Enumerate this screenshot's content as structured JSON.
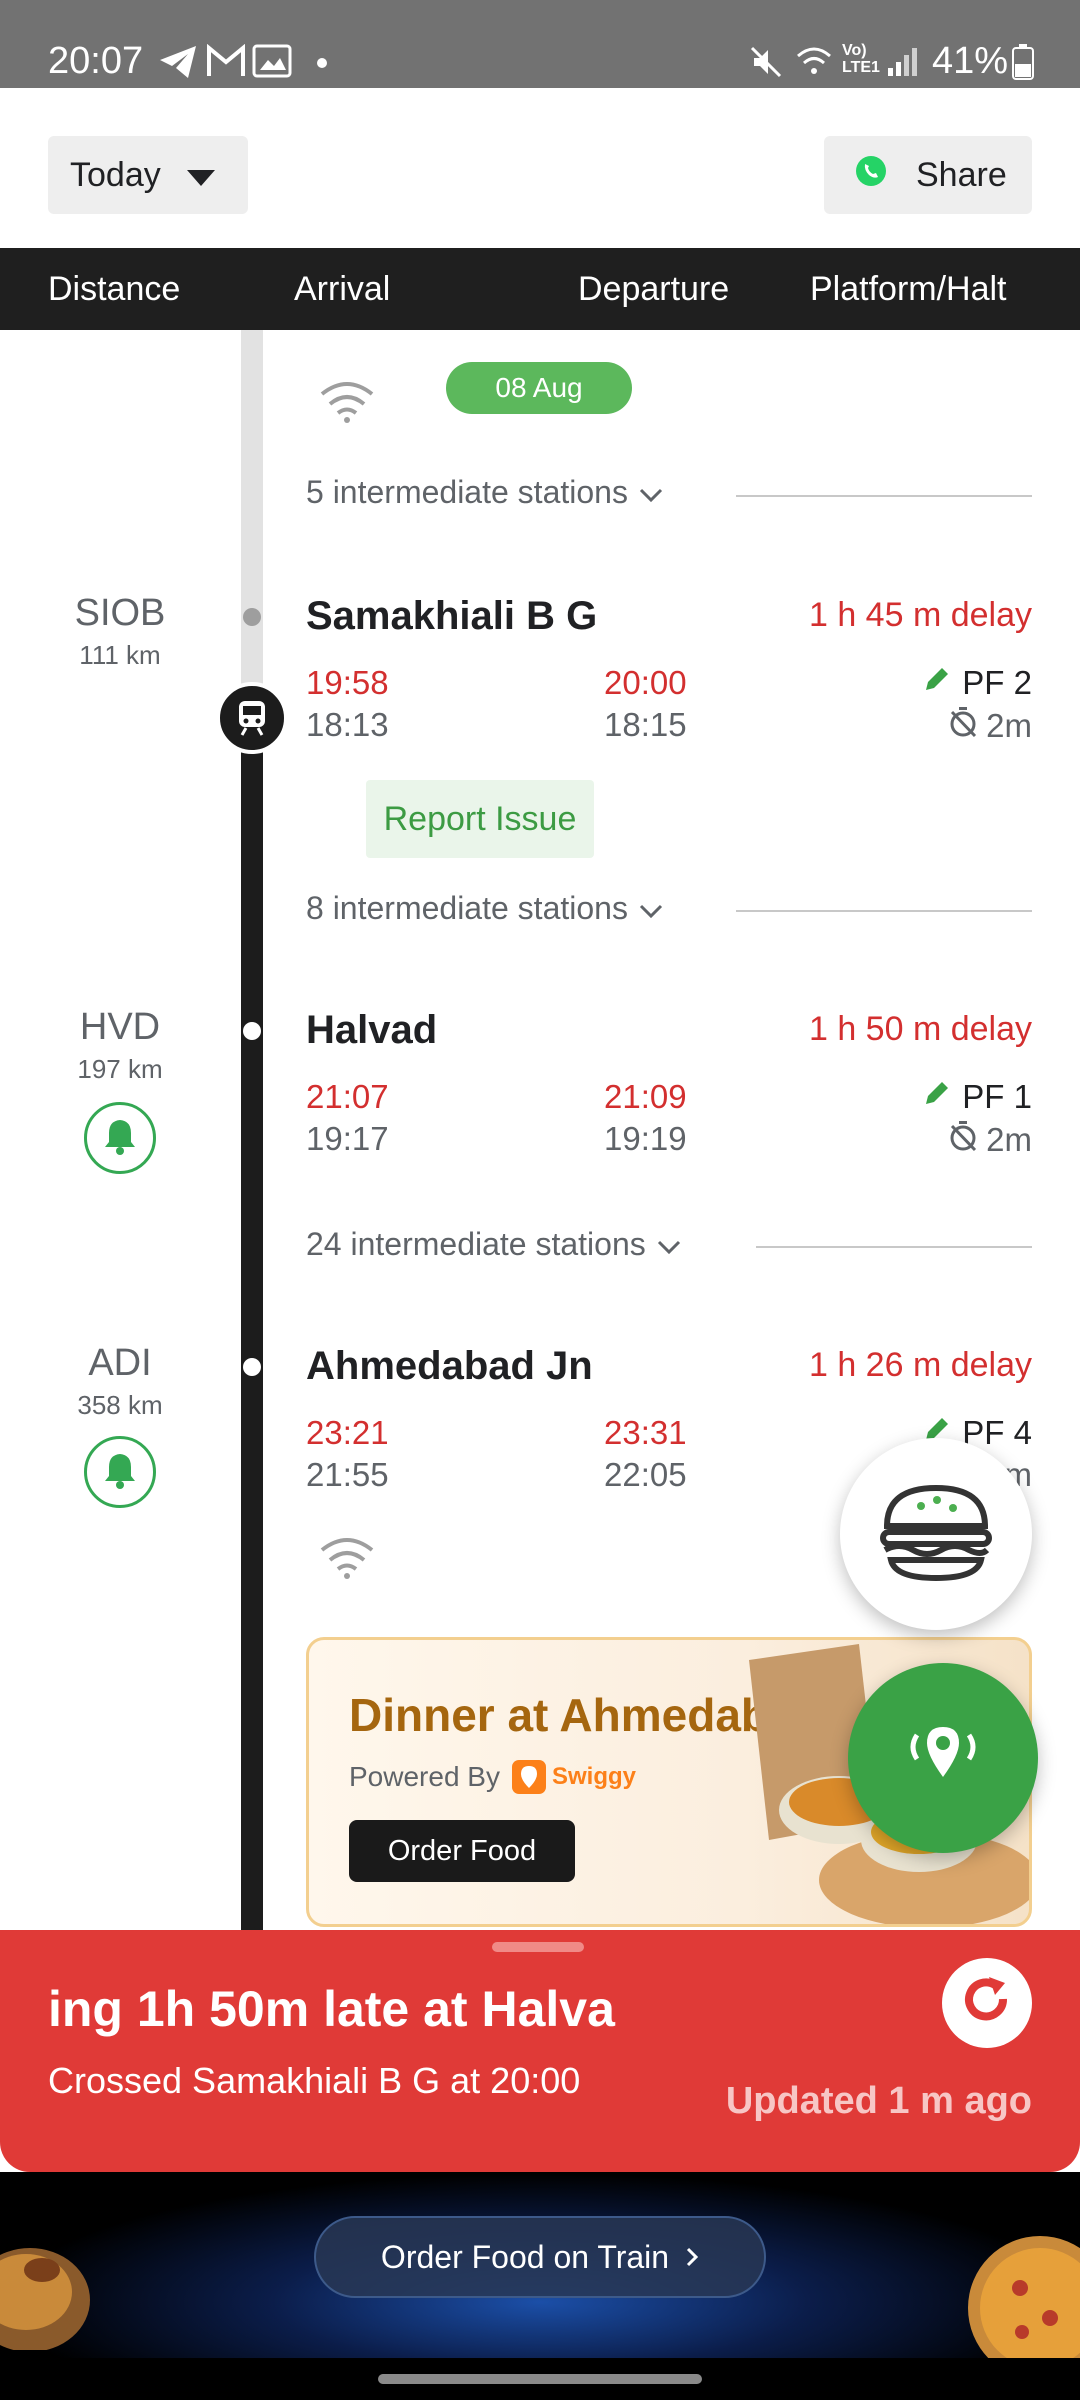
{
  "status_bar": {
    "time": "20:07",
    "battery": "41%"
  },
  "top_bar": {
    "date_selector": "Today",
    "share_label": "Share"
  },
  "columns": {
    "distance": "Distance",
    "arrival": "Arrival",
    "departure": "Departure",
    "platform": "Platform/Halt"
  },
  "timeline": {
    "date_pill": "08 Aug",
    "intermediate_1": "5 intermediate stations",
    "intermediate_2": "8 intermediate stations",
    "intermediate_3": "24 intermediate stations",
    "report_issue": "Report Issue",
    "stations": [
      {
        "code": "SIOB",
        "km": "111 km",
        "name": "Samakhiali B G",
        "delay": "1 h 45 m delay",
        "arr_actual": "19:58",
        "arr_sched": "18:13",
        "dep_actual": "20:00",
        "dep_sched": "18:15",
        "platform": "PF 2",
        "halt": "2m"
      },
      {
        "code": "HVD",
        "km": "197 km",
        "name": "Halvad",
        "delay": "1 h 50 m delay",
        "arr_actual": "21:07",
        "arr_sched": "19:17",
        "dep_actual": "21:09",
        "dep_sched": "19:19",
        "platform": "PF 1",
        "halt": "2m"
      },
      {
        "code": "ADI",
        "km": "358 km",
        "name": "Ahmedabad Jn",
        "delay": "1 h 26 m delay",
        "arr_actual": "23:21",
        "arr_sched": "21:55",
        "dep_actual": "23:31",
        "dep_sched": "22:05",
        "platform": "PF 4",
        "halt": "m"
      }
    ]
  },
  "food_card": {
    "title": "Dinner at Ahmedabad",
    "powered_by": "Powered By",
    "brand": "Swiggy",
    "button": "Order Food"
  },
  "status_panel": {
    "marquee": "ing 1h 50m late at Halva",
    "crossed": "Crossed Samakhiali B G at 20:00",
    "updated": "Updated 1 m  ago"
  },
  "banner": {
    "button": "Order Food on Train"
  },
  "colors": {
    "delay_red": "#d32f2f",
    "accent_green": "#3aa246",
    "panel_red": "#e03a37",
    "header_dark": "#1f1f1f"
  }
}
